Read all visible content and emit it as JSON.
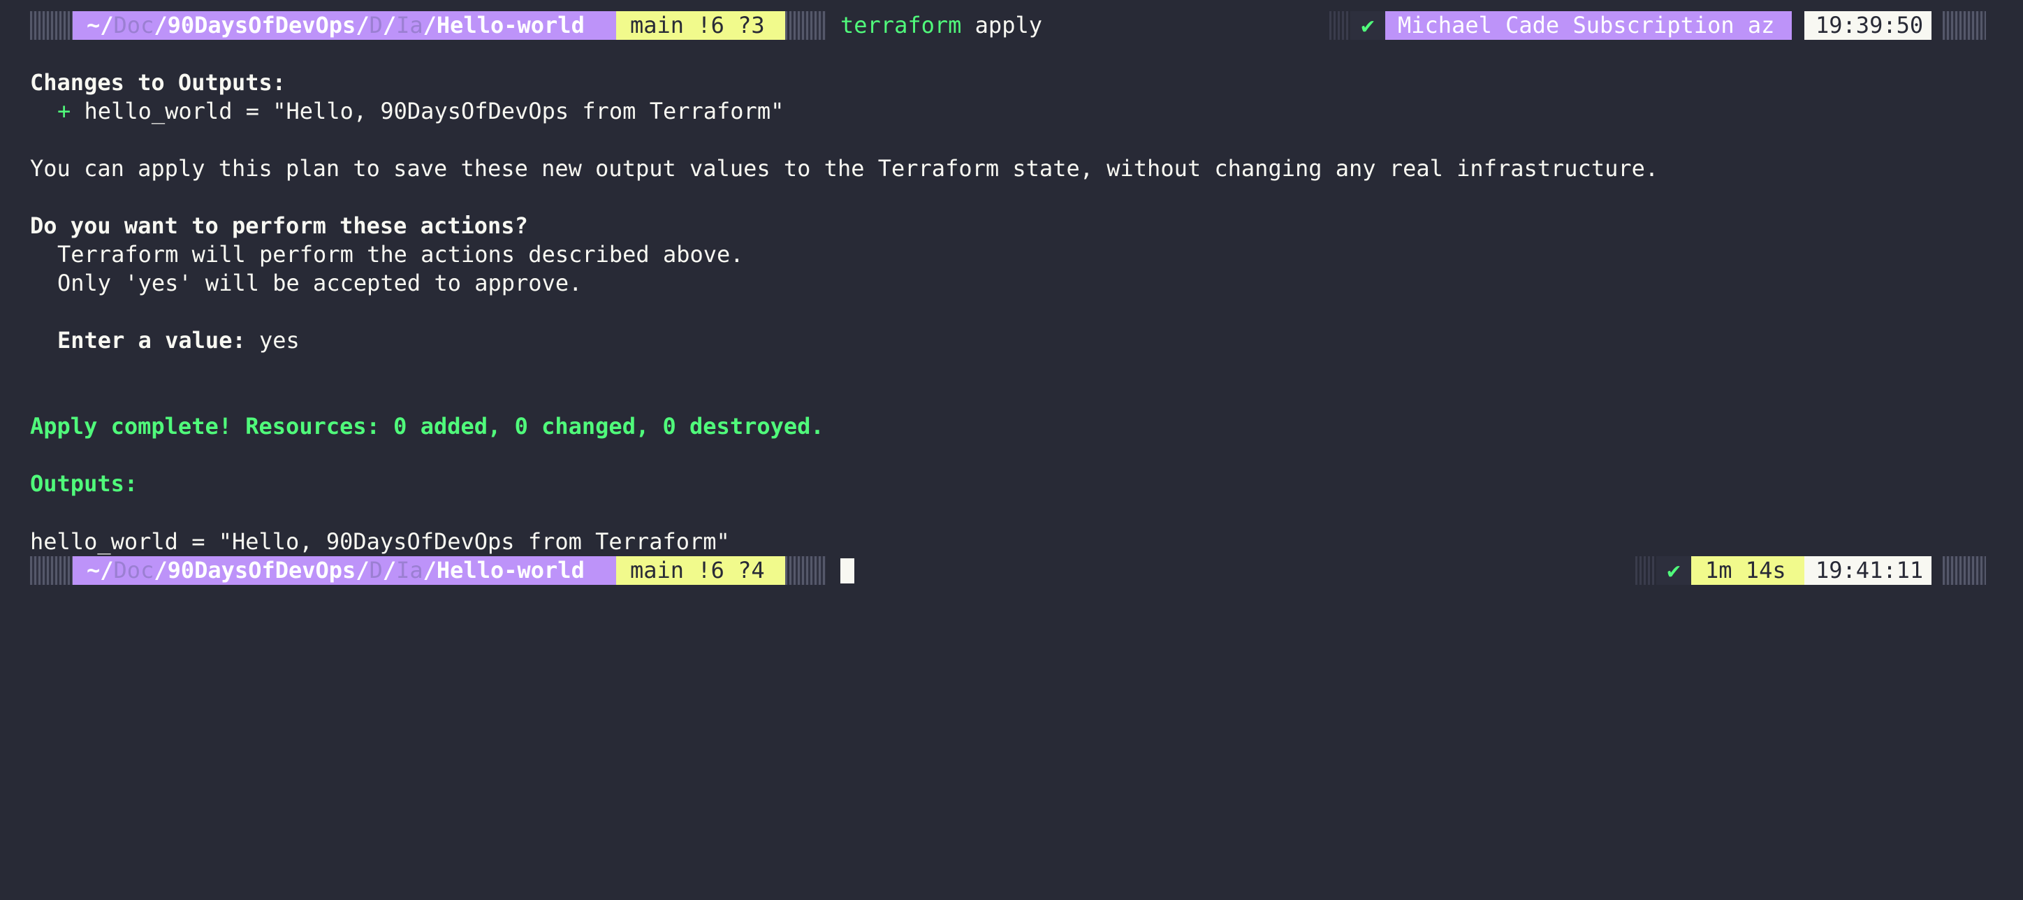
{
  "prompt_top": {
    "path_home": "~/",
    "path_seg1": "Doc",
    "path_sep1": "/",
    "path_seg2": "90DaysOfDevOps",
    "path_sep2": "/",
    "path_seg3": "D",
    "path_sep3": "/",
    "path_seg4": "Ia",
    "path_sep4": "/",
    "path_seg5": "Hello-world",
    "git_status": "main !6 ?3",
    "command_name": "terraform",
    "command_args": " apply",
    "status_check": "✔",
    "context": "Michael Cade Subscription az",
    "time": "19:39:50"
  },
  "output": {
    "changes_header": "Changes to Outputs:",
    "plus": "+",
    "change_line": " hello_world = \"Hello, 90DaysOfDevOps from Terraform\"",
    "apply_note": "You can apply this plan to save these new output values to the Terraform state, without changing any real infrastructure.",
    "question": "Do you want to perform these actions?",
    "info1": "Terraform will perform the actions described above.",
    "info2": "Only 'yes' will be accepted to approve.",
    "enter_label": "Enter a value:",
    "enter_value": " yes",
    "complete": "Apply complete! Resources: 0 added, 0 changed, 0 destroyed.",
    "outputs_header": "Outputs:",
    "output_line": "hello_world = \"Hello, 90DaysOfDevOps from Terraform\""
  },
  "prompt_bottom": {
    "path_home": "~/",
    "path_seg1": "Doc",
    "path_sep1": "/",
    "path_seg2": "90DaysOfDevOps",
    "path_sep2": "/",
    "path_seg3": "D",
    "path_sep3": "/",
    "path_seg4": "Ia",
    "path_sep4": "/",
    "path_seg5": "Hello-world",
    "git_status": "main !6 ?4",
    "status_check": "✔",
    "duration": "1m 14s",
    "time": "19:41:11"
  },
  "colors": {
    "background": "#282a36",
    "foreground": "#f8f8f2",
    "green": "#50fa7b",
    "purple": "#bd93f9",
    "yellow": "#f1fa8c"
  }
}
